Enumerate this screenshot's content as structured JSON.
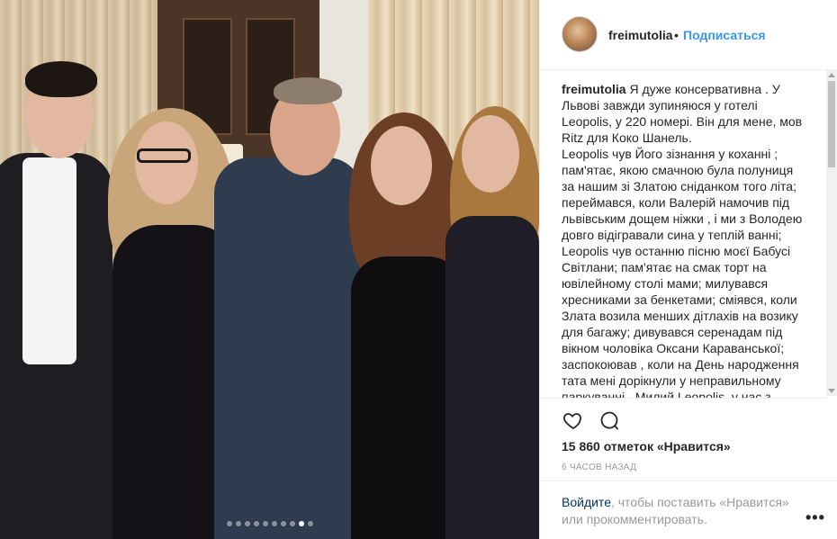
{
  "post": {
    "username": "freimutolia",
    "separator": "•",
    "follow_label": "Подписаться",
    "caption_user": "freimutolia",
    "caption_lines": [
      "Я дуже консервативна . У",
      "Львові завжди зупиняюся у готелі",
      "Leopolis, у 220 номері. Він для мене, мов",
      "Ritz для Коко Шанель.",
      "Leopolis чув Його зізнання у коханні ;",
      "пам'ятає, якою смачною була полуниця",
      "за нашим зі Златою сніданком того літа;",
      "переймався, коли Валерій намочив під",
      "львівським дощем ніжки , і ми з Володею",
      "довго відігравали сина у теплій ванні;",
      "Leopolis чув останню пісню моєї Бабусі",
      "Світлани; пам'ятає на смак торт на",
      "ювілейному столі мами; милувався",
      "хресниками за бенкетами; сміявся, коли",
      "Злата возила менших дітлахів на возику",
      "для багажу; дивувався серенадам під",
      "вікном чоловіка Оксани Караванської;",
      "заспокоював , коли на День народження",
      "тата мені дорікнули у неправильному",
      "паркуванні . Милий Leopolis, у нас з"
    ],
    "likes": "15 860 отметок «Нравится»",
    "time": "6 ЧАСОВ НАЗАД",
    "login_link": "Войдите",
    "login_rest": ", чтобы поставить «Нравится» или прокомментировать.",
    "more_label": "•••"
  },
  "carousel": {
    "count": 10,
    "active_index": 8
  },
  "icons": {
    "like": "heart-icon",
    "comment": "comment-icon",
    "more": "more-options-icon"
  },
  "colors": {
    "link_blue": "#3897f0",
    "login_link": "#003569",
    "text": "#262626",
    "muted": "#999999"
  }
}
